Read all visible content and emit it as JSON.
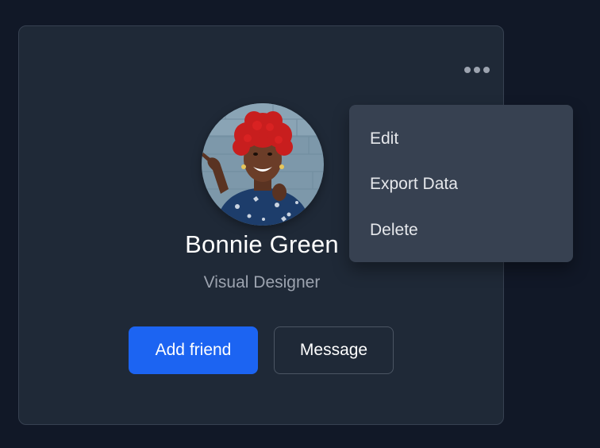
{
  "profile": {
    "name": "Bonnie Green",
    "role": "Visual Designer",
    "avatar_icon": "profile-photo"
  },
  "actions": {
    "add_friend_label": "Add friend",
    "message_label": "Message"
  },
  "menu": {
    "trigger_icon": "more-horizontal-icon",
    "items": [
      {
        "label": "Edit"
      },
      {
        "label": "Export Data"
      },
      {
        "label": "Delete"
      }
    ]
  },
  "colors": {
    "page_background": "#111827",
    "card_background": "#1f2937",
    "primary": "#1c64f2",
    "dropdown_background": "#374151",
    "muted_text": "#9ca3af"
  }
}
